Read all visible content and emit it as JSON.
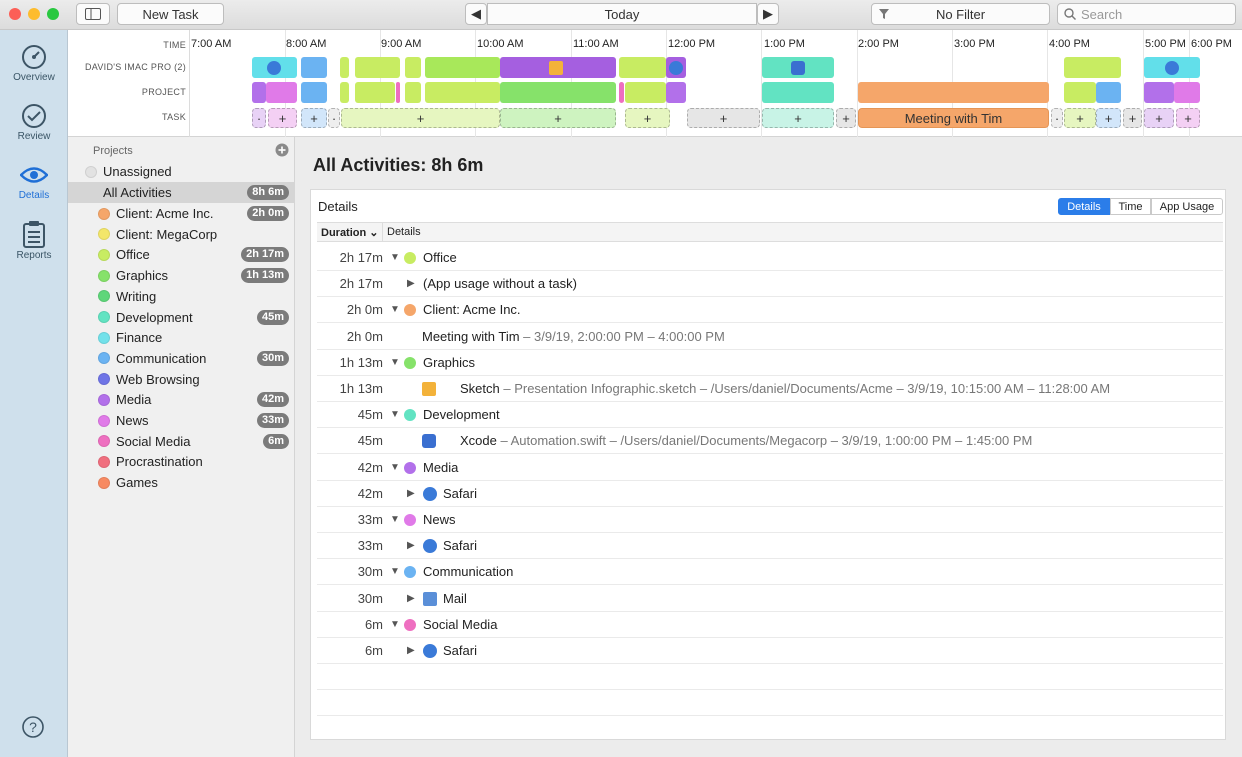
{
  "toolbar": {
    "new_task": "New Task",
    "date": "Today",
    "filter": "No Filter",
    "search_placeholder": "Search"
  },
  "rail": {
    "overview": "Overview",
    "review": "Review",
    "details": "Details",
    "reports": "Reports"
  },
  "timeline": {
    "labels": {
      "time": "TIME",
      "device": "DAVID'S IMAC PRO (2)",
      "project": "PROJECT",
      "task": "TASK"
    },
    "ticks": [
      "7:00 AM",
      "8:00 AM",
      "9:00 AM",
      "10:00 AM",
      "11:00 AM",
      "12:00 PM",
      "1:00 PM",
      "2:00 PM",
      "3:00 PM",
      "4:00 PM",
      "5:00 PM",
      "6:00 PM"
    ],
    "meeting_task": "Meeting with Tim"
  },
  "sidebar": {
    "heading": "Projects",
    "unassigned": "Unassigned",
    "all": {
      "label": "All Activities",
      "badge": "8h 6m"
    },
    "projects": [
      {
        "label": "Client: Acme Inc.",
        "badge": "2h 0m",
        "color": "#f5a66a"
      },
      {
        "label": "Client: MegaCorp",
        "badge": "",
        "color": "#f3e66a"
      },
      {
        "label": "Office",
        "badge": "2h 17m",
        "color": "#c8ec62"
      },
      {
        "label": "Graphics",
        "badge": "1h 13m",
        "color": "#86e26a"
      },
      {
        "label": "Writing",
        "badge": "",
        "color": "#5ed67a"
      },
      {
        "label": "Development",
        "badge": "45m",
        "color": "#62e3c2"
      },
      {
        "label": "Finance",
        "badge": "",
        "color": "#72e1ea"
      },
      {
        "label": "Communication",
        "badge": "30m",
        "color": "#6bb3f2"
      },
      {
        "label": "Web Browsing",
        "badge": "",
        "color": "#6f74e6"
      },
      {
        "label": "Media",
        "badge": "42m",
        "color": "#b270ea"
      },
      {
        "label": "News",
        "badge": "33m",
        "color": "#e07ae8"
      },
      {
        "label": "Social Media",
        "badge": "6m",
        "color": "#ee6fc0"
      },
      {
        "label": "Procrastination",
        "badge": "",
        "color": "#f06e7e"
      },
      {
        "label": "Games",
        "badge": "",
        "color": "#f78a62"
      }
    ]
  },
  "main": {
    "title": "All Activities: 8h 6m",
    "panel_title": "Details",
    "segments": [
      "Details",
      "Time",
      "App Usage"
    ],
    "col_duration": "Duration",
    "col_details": "Details",
    "rows": [
      {
        "dur": "2h 17m",
        "label": "Office",
        "color": "#c8ec62"
      },
      {
        "dur": "2h 17m",
        "label": "(App usage without a task)"
      },
      {
        "dur": "2h 0m",
        "label": "Client: Acme Inc.",
        "color": "#f5a66a"
      },
      {
        "dur": "2h 0m",
        "label": "Meeting with Tim",
        "meta": " – 3/9/19, 2:00:00 PM – 4:00:00 PM"
      },
      {
        "dur": "1h 13m",
        "label": "Graphics",
        "color": "#86e26a"
      },
      {
        "dur": "1h 13m",
        "label": "Sketch",
        "meta": " – Presentation Infographic.sketch – /Users/daniel/Documents/Acme – 3/9/19, 10:15:00 AM – 11:28:00 AM"
      },
      {
        "dur": "45m",
        "label": "Development",
        "color": "#62e3c2"
      },
      {
        "dur": "45m",
        "label": "Xcode",
        "meta": " – Automation.swift – /Users/daniel/Documents/Megacorp – 3/9/19, 1:00:00 PM – 1:45:00 PM"
      },
      {
        "dur": "42m",
        "label": "Media",
        "color": "#b270ea"
      },
      {
        "dur": "42m",
        "label": "Safari"
      },
      {
        "dur": "33m",
        "label": "News",
        "color": "#e07ae8"
      },
      {
        "dur": "33m",
        "label": "Safari"
      },
      {
        "dur": "30m",
        "label": "Communication",
        "color": "#6bb3f2"
      },
      {
        "dur": "30m",
        "label": "Mail"
      },
      {
        "dur": "6m",
        "label": "Social Media",
        "color": "#ee6fc0"
      },
      {
        "dur": "6m",
        "label": "Safari"
      }
    ]
  }
}
